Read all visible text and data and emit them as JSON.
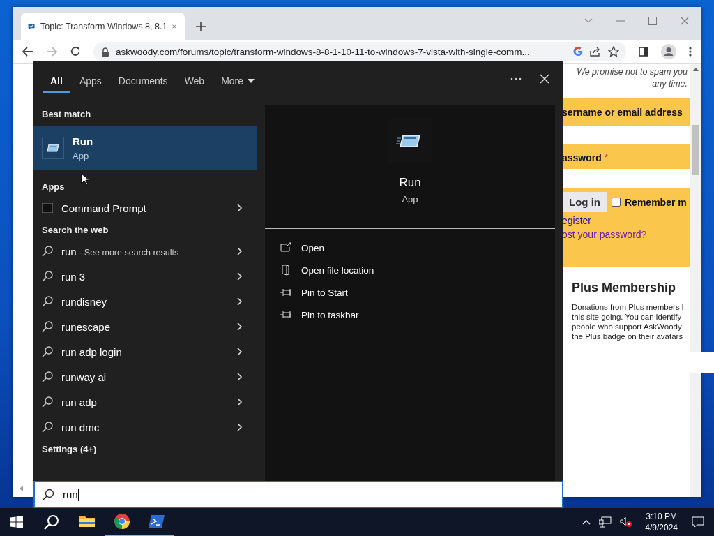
{
  "browser": {
    "tab": {
      "title": "Topic: Transform Windows 8, 8.1",
      "selected": true
    },
    "forward_disabled": true,
    "address": "askwoody.com/forums/topic/transform-windows-8-8-1-10-11-to-windows-7-vista-with-single-comm...",
    "page": {
      "notice_lines": [
        "We promise not to spam you",
        "any time."
      ],
      "username_label": "sername or email address",
      "password_label": "assword",
      "required_mark": "*",
      "login_button": "Log in",
      "remember": {
        "label": "Remember m",
        "checked": false
      },
      "links": [
        {
          "text": "egister",
          "visited": false
        },
        {
          "text": "ost your password?",
          "visited": true
        }
      ],
      "heading": "Plus Membership",
      "paragraph_lines": [
        "Donations from Plus members l",
        "this site going. You can identify",
        "people who support AskWoody",
        "the Plus badge on their avatars"
      ]
    }
  },
  "search": {
    "tabs": [
      {
        "label": "All",
        "kind": "plain",
        "selected": true
      },
      {
        "label": "Apps",
        "kind": "plain",
        "selected": false
      },
      {
        "label": "Documents",
        "kind": "plain",
        "selected": false
      },
      {
        "label": "Web",
        "kind": "plain",
        "selected": false
      },
      {
        "label": "More",
        "kind": "dropdown",
        "selected": false
      }
    ],
    "results": [
      {
        "kind": "header",
        "text": "Best match"
      },
      {
        "kind": "best",
        "title": "Run",
        "subtitle": "App",
        "selected": true
      },
      {
        "kind": "header",
        "text": "Apps"
      },
      {
        "kind": "app",
        "title": "Command Prompt",
        "selected": false
      },
      {
        "kind": "header",
        "text": "Search the web"
      },
      {
        "kind": "web",
        "title": "run",
        "suffix": " - See more search results",
        "selected": false
      },
      {
        "kind": "web",
        "title": "run 3",
        "selected": false
      },
      {
        "kind": "web",
        "title": "rundisney",
        "selected": false
      },
      {
        "kind": "web",
        "title": "runescape",
        "selected": false
      },
      {
        "kind": "web",
        "title": "run adp login",
        "selected": false
      },
      {
        "kind": "web",
        "title": "runway ai",
        "selected": false
      },
      {
        "kind": "web",
        "title": "run adp",
        "selected": false
      },
      {
        "kind": "web",
        "title": "run dmc",
        "selected": false
      },
      {
        "kind": "header",
        "text": "Settings (4+)"
      }
    ],
    "preview": {
      "title": "Run",
      "subtitle": "App"
    },
    "actions": [
      {
        "kind": "open",
        "label": "Open"
      },
      {
        "kind": "folder",
        "label": "Open file location"
      },
      {
        "kind": "pin",
        "label": "Pin to Start"
      },
      {
        "kind": "pin",
        "label": "Pin to taskbar"
      }
    ],
    "query": "run"
  },
  "taskbar": {
    "apps": [
      {
        "kind": "explorer",
        "running": false
      },
      {
        "kind": "chrome",
        "running": true
      },
      {
        "kind": "powershell",
        "running": true
      }
    ],
    "time": "3:10 PM",
    "date": "4/9/2024"
  }
}
